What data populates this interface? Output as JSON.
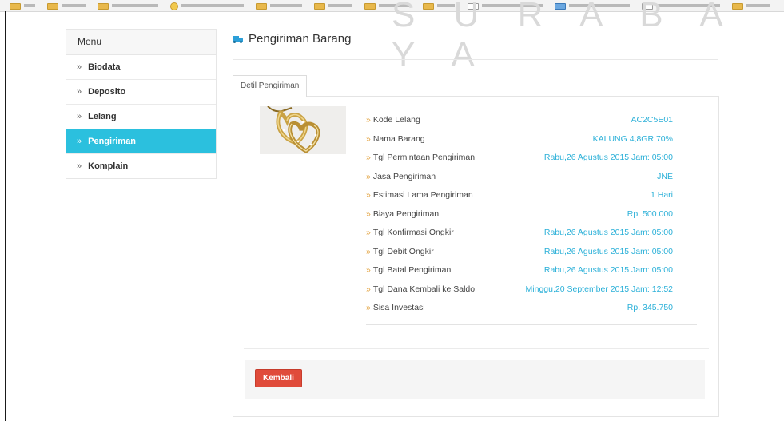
{
  "watermark": "S U R A B A Y A",
  "sidebar": {
    "header": "Menu",
    "chevron": "»",
    "items": [
      {
        "label": "Biodata",
        "active": false
      },
      {
        "label": "Deposito",
        "active": false
      },
      {
        "label": "Lelang",
        "active": false
      },
      {
        "label": "Pengiriman",
        "active": true
      },
      {
        "label": "Komplain",
        "active": false
      }
    ]
  },
  "page": {
    "title": "Pengiriman Barang",
    "title_icon": "truck-icon",
    "tab_label": "Detil Pengiriman",
    "product_image": "gold-heart-necklace-photo"
  },
  "details": {
    "arrow": "»",
    "rows": [
      {
        "label": "Kode Lelang",
        "value": "AC2C5E01"
      },
      {
        "label": "Nama Barang",
        "value": "KALUNG 4,8GR 70%"
      },
      {
        "label": "Tgl Permintaan Pengiriman",
        "value": "Rabu,26 Agustus 2015 Jam: 05:00"
      },
      {
        "label": "Jasa Pengiriman",
        "value": "JNE"
      },
      {
        "label": "Estimasi Lama Pengiriman",
        "value": "1 Hari"
      },
      {
        "label": "Biaya Pengiriman",
        "value": "Rp. 500.000"
      },
      {
        "label": "Tgl Konfirmasi Ongkir",
        "value": "Rabu,26 Agustus 2015 Jam: 05:00"
      },
      {
        "label": "Tgl Debit Ongkir",
        "value": "Rabu,26 Agustus 2015 Jam: 05:00"
      },
      {
        "label": "Tgl Batal Pengiriman",
        "value": "Rabu,26 Agustus 2015 Jam: 05:00"
      },
      {
        "label": "Tgl Dana Kembali ke Saldo",
        "value": "Minggu,20 September 2015 Jam: 12:52"
      },
      {
        "label": "Sisa Investasi",
        "value": "Rp. 345.750"
      }
    ]
  },
  "footer": {
    "back_label": "Kembali"
  },
  "colors": {
    "accent": "#2bc0de",
    "value_text": "#2bb0d8",
    "arrow": "#e2a13c",
    "danger": "#e04b3a"
  }
}
